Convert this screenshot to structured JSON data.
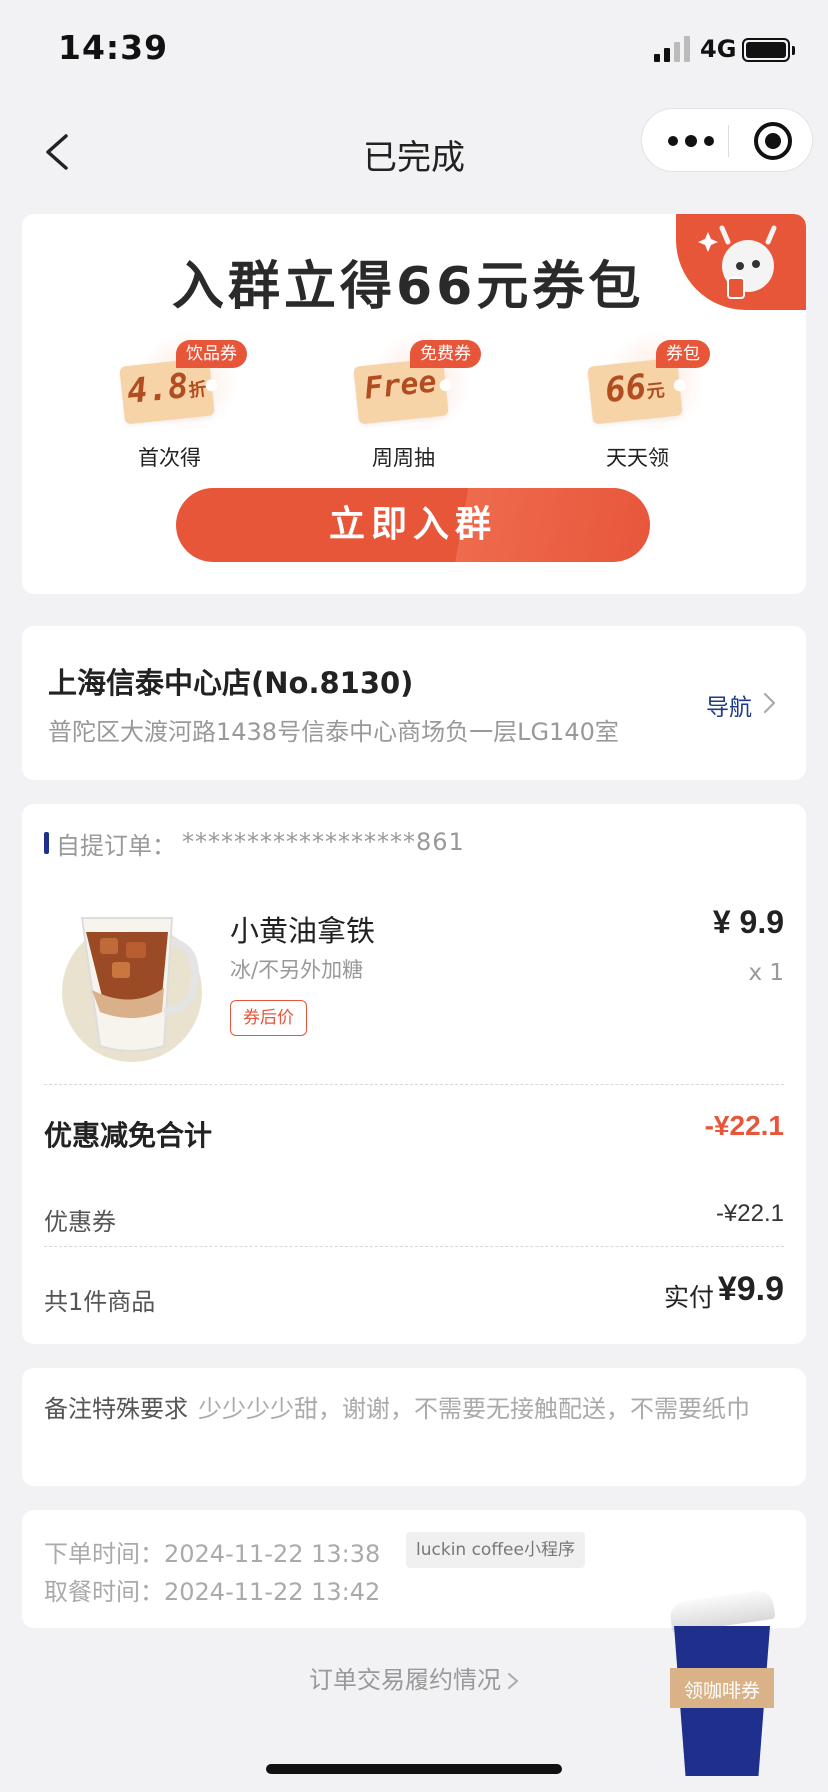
{
  "status_bar": {
    "time": "14:39",
    "network": "4G"
  },
  "nav": {
    "title": "已完成"
  },
  "banner": {
    "title": "入群立得66元券包",
    "perks": [
      {
        "badge": "饮品券",
        "ticket_main": "4.8",
        "ticket_unit": "折",
        "label": "首次得"
      },
      {
        "badge": "免费券",
        "ticket_main": "Free",
        "ticket_unit": "",
        "label": "周周抽"
      },
      {
        "badge": "券包",
        "ticket_main": "66",
        "ticket_unit": "元",
        "label": "天天领"
      }
    ],
    "join_button": "立即入群",
    "accent_color": "#e8563a"
  },
  "store": {
    "name": "上海信泰中心店(No.8130)",
    "address": "普陀区大渡河路1438号信泰中心商场负一层LG140室",
    "nav_label": "导航"
  },
  "order": {
    "type_label": "自提订单：",
    "number": "******************861",
    "product": {
      "name": "小黄油拿铁",
      "spec": "冰/不另外加糖",
      "tag": "券后价",
      "price": "¥ 9.9",
      "qty": "x 1"
    },
    "discount_title": "优惠减免合计",
    "discount_total": "-¥22.1",
    "coupon_label": "优惠券",
    "coupon_value": "-¥22.1",
    "items_count": "共1件商品",
    "paid_label": "实付",
    "paid_value": "¥9.9"
  },
  "remark": {
    "label": "备注特殊要求",
    "text": "少少少少甜，谢谢，不需要无接触配送，不需要纸巾"
  },
  "times": {
    "order_time_label": "下单时间：",
    "order_time": "2024-11-22 13:38",
    "source": "luckin coffee小程序",
    "pickup_time_label": "取餐时间：",
    "pickup_time": "2024-11-22 13:42"
  },
  "footer_link": "订单交易履约情况",
  "floating": {
    "label": "领咖啡券"
  }
}
